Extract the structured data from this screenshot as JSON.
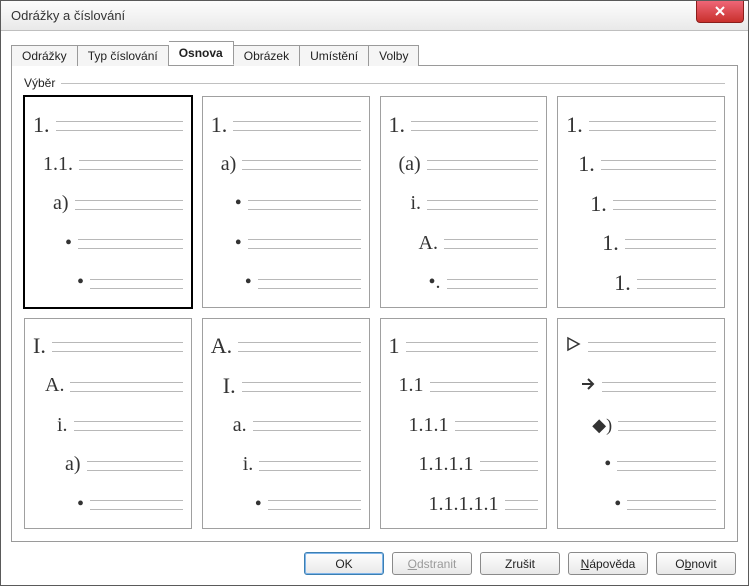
{
  "window": {
    "title": "Odrážky a číslování"
  },
  "tabs": [
    {
      "label": "Odrážky"
    },
    {
      "label": "Typ číslování"
    },
    {
      "label": "Osnova"
    },
    {
      "label": "Obrázek"
    },
    {
      "label": "Umístění"
    },
    {
      "label": "Volby"
    }
  ],
  "active_tab_index": 2,
  "group": {
    "label": "Výběr"
  },
  "options": [
    {
      "selected": true,
      "levels": [
        {
          "indent": 0,
          "text": "1.",
          "size": 22
        },
        {
          "indent": 10,
          "text": "1.1.",
          "size": 20
        },
        {
          "indent": 20,
          "text": "a)",
          "size": 20
        },
        {
          "indent": 32,
          "text": "•",
          "size": 20
        },
        {
          "indent": 44,
          "text": "•",
          "size": 20
        }
      ]
    },
    {
      "selected": false,
      "levels": [
        {
          "indent": 0,
          "text": "1.",
          "size": 22
        },
        {
          "indent": 10,
          "text": "a)",
          "size": 20
        },
        {
          "indent": 24,
          "text": "•",
          "size": 20
        },
        {
          "indent": 24,
          "text": "•",
          "size": 20
        },
        {
          "indent": 34,
          "text": "•",
          "size": 20
        }
      ]
    },
    {
      "selected": false,
      "levels": [
        {
          "indent": 0,
          "text": "1.",
          "size": 22
        },
        {
          "indent": 10,
          "text": "(a)",
          "size": 20
        },
        {
          "indent": 22,
          "text": "i.",
          "size": 20
        },
        {
          "indent": 30,
          "text": "A.",
          "size": 20
        },
        {
          "indent": 40,
          "text": "•.",
          "size": 20
        }
      ]
    },
    {
      "selected": false,
      "levels": [
        {
          "indent": 0,
          "text": "1.",
          "size": 22
        },
        {
          "indent": 12,
          "text": "1.",
          "size": 22
        },
        {
          "indent": 24,
          "text": "1.",
          "size": 22
        },
        {
          "indent": 36,
          "text": "1.",
          "size": 22
        },
        {
          "indent": 48,
          "text": "1.",
          "size": 22
        }
      ]
    },
    {
      "selected": false,
      "levels": [
        {
          "indent": 0,
          "text": "I.",
          "size": 22
        },
        {
          "indent": 12,
          "text": "A.",
          "size": 20
        },
        {
          "indent": 24,
          "text": "i.",
          "size": 20
        },
        {
          "indent": 32,
          "text": "a)",
          "size": 20
        },
        {
          "indent": 44,
          "text": "•",
          "size": 20
        }
      ]
    },
    {
      "selected": false,
      "levels": [
        {
          "indent": 0,
          "text": "A.",
          "size": 22
        },
        {
          "indent": 12,
          "text": "I.",
          "size": 22
        },
        {
          "indent": 22,
          "text": "a.",
          "size": 20
        },
        {
          "indent": 32,
          "text": "i.",
          "size": 20
        },
        {
          "indent": 44,
          "text": "•",
          "size": 20
        }
      ]
    },
    {
      "selected": false,
      "levels": [
        {
          "indent": 0,
          "text": "1",
          "size": 22
        },
        {
          "indent": 10,
          "text": "1.1",
          "size": 20
        },
        {
          "indent": 20,
          "text": "1.1.1",
          "size": 20
        },
        {
          "indent": 30,
          "text": "1.1.1.1",
          "size": 20
        },
        {
          "indent": 40,
          "text": "1.1.1.1.1",
          "size": 20
        }
      ]
    },
    {
      "selected": false,
      "levels": [
        {
          "indent": 0,
          "svg": "arrowhead"
        },
        {
          "indent": 14,
          "svg": "arrow"
        },
        {
          "indent": 26,
          "text": "◆)",
          "size": 18
        },
        {
          "indent": 38,
          "text": "•",
          "size": 20
        },
        {
          "indent": 48,
          "text": "•",
          "size": 20
        }
      ]
    }
  ],
  "buttons": {
    "ok": {
      "label": "OK",
      "default": true,
      "enabled": true
    },
    "remove": {
      "label": "Odstranit",
      "accel_index": 0,
      "enabled": false
    },
    "cancel": {
      "label": "Zrušit",
      "enabled": true
    },
    "help": {
      "label": "Nápověda",
      "accel_index": 0,
      "enabled": true
    },
    "reset": {
      "label": "Obnovit",
      "accel_index": 1,
      "enabled": true
    }
  }
}
